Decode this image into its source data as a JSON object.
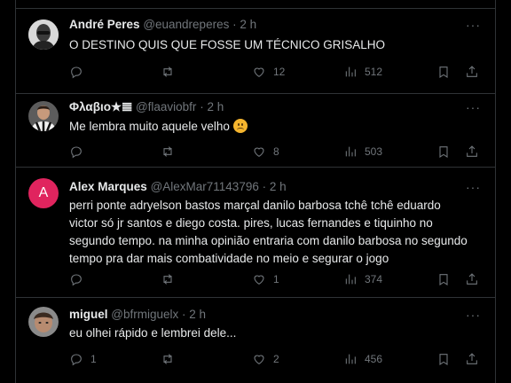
{
  "colors": {
    "background": "#000000",
    "text": "#e7e9ea",
    "muted": "#71767b",
    "divider": "#2f3336",
    "avatar_letter_bg": "#e0245e"
  },
  "replies": [
    {
      "name": "André Peres",
      "handle": "@euandreperes",
      "dot": "·",
      "time": "2 h",
      "text": "O DESTINO QUIS QUE FOSSE UM TÉCNICO GRISALHO",
      "replies_count": "",
      "reposts_count": "",
      "likes_count": "12",
      "views_count": "512"
    },
    {
      "name": "Φλαβιο★𝌆",
      "handle": "@flaaviobfr",
      "dot": "·",
      "time": "2 h",
      "text": "Me lembra muito aquele velho",
      "emoji": "frowning-face",
      "replies_count": "",
      "reposts_count": "",
      "likes_count": "8",
      "views_count": "503"
    },
    {
      "name": "Alex Marques",
      "handle": "@AlexMar71143796",
      "dot": "·",
      "time": "2 h",
      "avatar_letter": "A",
      "text": "perri ponte adryelson bastos marçal danilo barbosa tchê tchê eduardo victor só jr santos e diego costa. pires, lucas fernandes e tiquinho no segundo tempo. na minha opinião entraria com danilo barbosa no segundo tempo pra dar mais combatividade no meio e segurar o jogo",
      "replies_count": "",
      "reposts_count": "",
      "likes_count": "1",
      "views_count": "374"
    },
    {
      "name": "miguel",
      "handle": "@bfrmiguelx",
      "dot": "·",
      "time": "2 h",
      "text": "eu olhei rápido e lembrei dele...",
      "replies_count": "1",
      "reposts_count": "",
      "likes_count": "2",
      "views_count": "456"
    }
  ],
  "icons": {
    "reply": "reply-icon",
    "repost": "repost-icon",
    "like": "heart-icon",
    "views": "views-icon",
    "bookmark": "bookmark-icon",
    "share": "share-icon",
    "more": "more-icon"
  }
}
